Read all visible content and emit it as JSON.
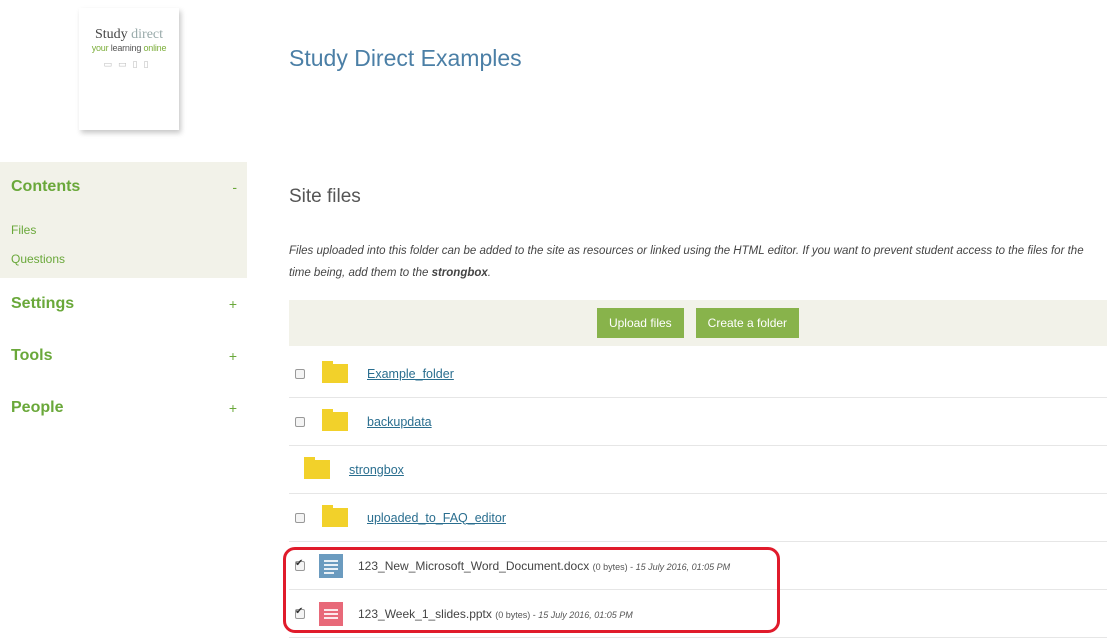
{
  "logo": {
    "study": "Study",
    "direct": "direct",
    "tagline_green_a": "your ",
    "tagline_green_b": "learning",
    "tagline_dark": " online"
  },
  "site_title": "Study Direct Examples",
  "sidebar": {
    "contents": {
      "label": "Contents",
      "toggle": "-"
    },
    "contents_items": [
      "Files",
      "Questions"
    ],
    "settings": {
      "label": "Settings",
      "toggle": "+"
    },
    "tools": {
      "label": "Tools",
      "toggle": "+"
    },
    "people": {
      "label": "People",
      "toggle": "+"
    }
  },
  "main": {
    "heading": "Site files",
    "intro_text": "Files uploaded into this folder can be added to the site as resources or linked using the HTML editor. If you want to prevent student access to the files for the time being, add them to the ",
    "intro_bold": "strongbox",
    "intro_end": ".",
    "upload_button": "Upload files",
    "create_folder_button": "Create a folder",
    "folders": [
      {
        "name": "Example_folder",
        "has_checkbox": true
      },
      {
        "name": "backupdata",
        "has_checkbox": true
      },
      {
        "name": "strongbox",
        "has_checkbox": false
      },
      {
        "name": "uploaded_to_FAQ_editor",
        "has_checkbox": true
      }
    ],
    "files": [
      {
        "name": "123_New_Microsoft_Word_Document.docx",
        "size": "(0 bytes)",
        "sep": " - ",
        "date": "15 July 2016, 01:05 PM",
        "checked": true,
        "icon": "word-document-icon"
      },
      {
        "name": "123_Week_1_slides.pptx",
        "size": "(0 bytes)",
        "sep": " - ",
        "date": "15 July 2016, 01:05 PM",
        "checked": true,
        "icon": "powerpoint-icon"
      }
    ]
  },
  "colors": {
    "accent_green": "#6aa83a",
    "button_green": "#88b34b",
    "link_blue": "#2a6e8f",
    "title_blue": "#4b7fa6",
    "highlight_red": "#e01b2b"
  }
}
